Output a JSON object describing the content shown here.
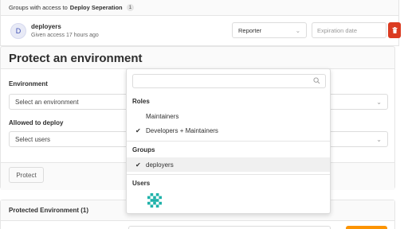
{
  "groups": {
    "header_prefix": "Groups with access to",
    "project_name": "Deploy Seperation",
    "count": "1",
    "member": {
      "avatar_letter": "D",
      "name": "deployers",
      "subtitle": "Given access 17 hours ago",
      "role": "Reporter",
      "expiration_placeholder": "Expiration date"
    }
  },
  "protect": {
    "title": "Protect an environment",
    "environment_label": "Environment",
    "environment_placeholder": "Select an environment",
    "allowed_label": "Allowed to deploy",
    "users_placeholder": "Select users",
    "protect_button": "Protect"
  },
  "dropdown": {
    "search_placeholder": "",
    "roles_title": "Roles",
    "roles": [
      {
        "label": "Maintainers",
        "checked": false
      },
      {
        "label": "Developers + Maintainers",
        "checked": true
      }
    ],
    "groups_title": "Groups",
    "groups": [
      {
        "label": "deployers",
        "checked": true
      }
    ],
    "users_title": "Users"
  },
  "protected": {
    "header": "Protected Environment (1)"
  },
  "colors": {
    "danger": "#db3b21",
    "warning": "#fc9403",
    "avatar_text": "#3f51b5",
    "identicon": "#20b2aa"
  },
  "icons": {
    "chevron": "chevron-down-icon",
    "check": "check-icon",
    "search": "search-icon",
    "trash": "trash-icon"
  }
}
